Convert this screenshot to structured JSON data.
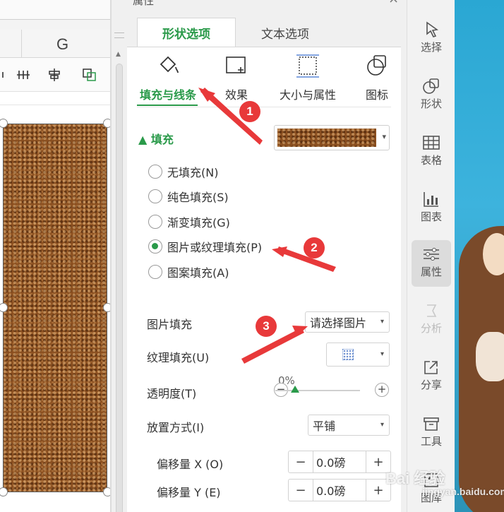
{
  "sheet": {
    "column_letter": "G"
  },
  "pane": {
    "title": "属性",
    "close": "×",
    "tabs": [
      {
        "label": "形状选项"
      },
      {
        "label": "文本选项"
      }
    ],
    "subtabs": [
      {
        "label": "填充与线条"
      },
      {
        "label": "效果"
      },
      {
        "label": "大小与属性"
      },
      {
        "label": "图标"
      }
    ],
    "fill": {
      "header": "填充",
      "options": [
        {
          "label": "无填充(N)",
          "selected": false
        },
        {
          "label": "纯色填充(S)",
          "selected": false
        },
        {
          "label": "渐变填充(G)",
          "selected": false
        },
        {
          "label": "图片或纹理填充(P)",
          "selected": true
        },
        {
          "label": "图案填充(A)",
          "selected": false
        }
      ],
      "picture_fill_label": "图片填充",
      "picture_fill_button": "请选择图片",
      "texture_fill_label": "纹理填充(U)",
      "transparency_label": "透明度(T)",
      "transparency_value": "0%",
      "placement_label": "放置方式(I)",
      "placement_value": "平铺",
      "offset_x_label": "偏移量 X (O)",
      "offset_x_value": "0.0磅",
      "offset_y_label": "偏移量 Y (E)",
      "offset_y_value": "0.0磅",
      "minus": "−",
      "plus": "+"
    }
  },
  "rail": {
    "items": [
      {
        "label": "选择",
        "icon": "cursor-icon"
      },
      {
        "label": "形状",
        "icon": "shapes-icon"
      },
      {
        "label": "表格",
        "icon": "table-icon"
      },
      {
        "label": "图表",
        "icon": "chart-icon"
      },
      {
        "label": "属性",
        "icon": "sliders-icon",
        "active": true
      },
      {
        "label": "分析",
        "icon": "analyze-icon",
        "disabled": true
      },
      {
        "label": "分享",
        "icon": "share-icon"
      },
      {
        "label": "工具",
        "icon": "toolbox-icon"
      },
      {
        "label": "图库",
        "icon": "gallery-icon"
      }
    ]
  },
  "annotations": {
    "badge1": "1",
    "badge2": "2",
    "badge3": "3",
    "color": "#e8393a"
  },
  "watermark": {
    "brand": "Bai 经验",
    "url": "jingyan.baidu.com"
  },
  "colors": {
    "accent": "#2a9a4a",
    "leather": "#8a4f20"
  }
}
